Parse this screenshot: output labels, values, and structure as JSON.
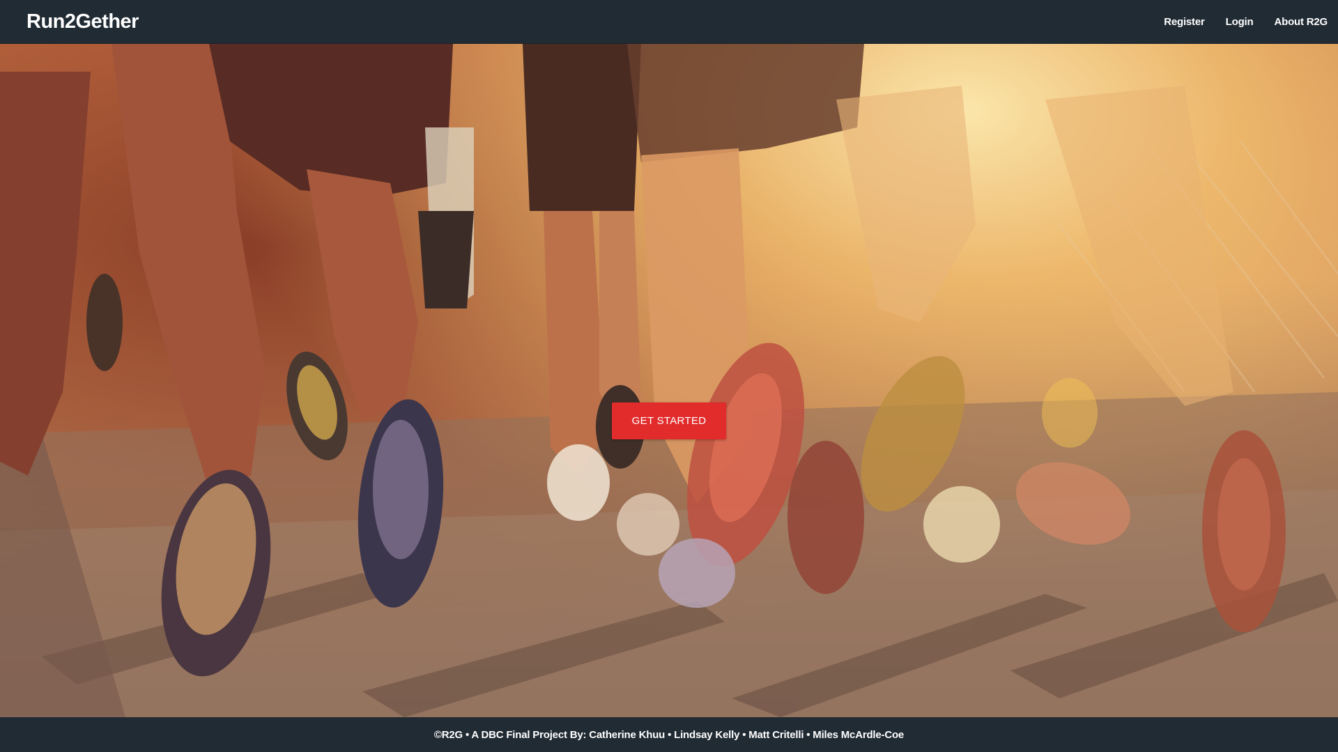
{
  "navbar": {
    "brand": "Run2Gether",
    "links": [
      "Register",
      "Login",
      "About R2G"
    ]
  },
  "hero": {
    "cta_label": "GET STARTED",
    "cta_color": "#e22c2c"
  },
  "footer": {
    "text": "©R2G • A DBC Final Project By: Catherine Khuu • Lindsay Kelly • Matt Critelli • Miles McArdle-Coe"
  },
  "colors": {
    "nav_bg": "#212b33",
    "footer_bg": "#212b33"
  }
}
